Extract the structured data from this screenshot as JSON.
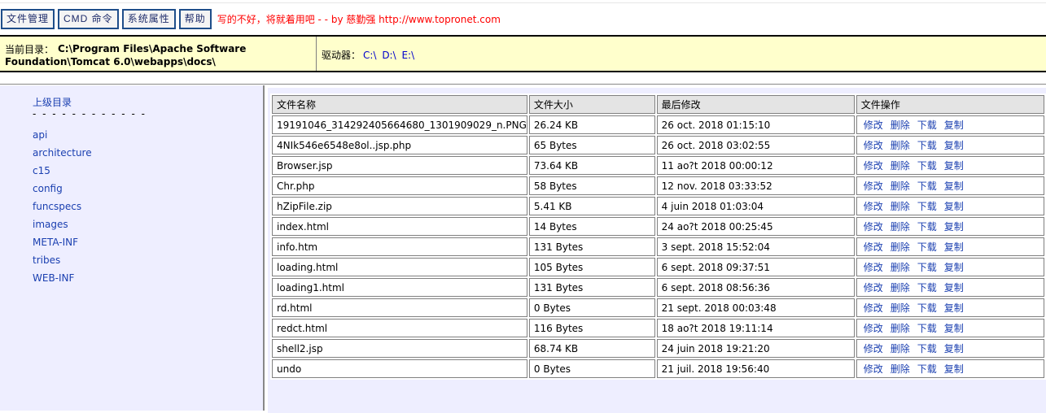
{
  "toolbar": {
    "buttons": [
      "文件管理",
      "CMD 命令",
      "系统属性",
      "帮助"
    ],
    "slogan": "写的不好，将就着用吧 - - by 慈勤强 http://www.topronet.com"
  },
  "pathbar": {
    "current_dir_label": "当前目录：",
    "current_dir_path": "C:\\Program Files\\Apache Software Foundation\\Tomcat 6.0\\webapps\\docs\\",
    "drives_label": "驱动器：",
    "drives": [
      "C:\\",
      "D:\\",
      "E:\\"
    ]
  },
  "sidebar": {
    "up_label": "上级目录",
    "separator": "- - - - - - - - - - - -",
    "dirs": [
      "api",
      "architecture",
      "c15",
      "config",
      "funcspecs",
      "images",
      "META-INF",
      "tribes",
      "WEB-INF"
    ]
  },
  "table": {
    "headers": [
      "文件名称",
      "文件大小",
      "最后修改",
      "文件操作"
    ],
    "ops": [
      "修改",
      "删除",
      "下载",
      "复制"
    ],
    "rows": [
      [
        "19191046_314292405664680_1301909029_n.PNG",
        "26.24 KB",
        "26 oct. 2018 01:15:10"
      ],
      [
        "4NIk546e6548e8ol..jsp.php",
        "65 Bytes",
        "26 oct. 2018 03:02:55"
      ],
      [
        "Browser.jsp",
        "73.64 KB",
        "11 ao?t 2018 00:00:12"
      ],
      [
        "Chr.php",
        "58 Bytes",
        "12 nov. 2018 03:33:52"
      ],
      [
        "hZipFile.zip",
        "5.41 KB",
        "4 juin 2018 01:03:04"
      ],
      [
        "index.html",
        "14 Bytes",
        "24 ao?t 2018 00:25:45"
      ],
      [
        "info.htm",
        "131 Bytes",
        "3 sept. 2018 15:52:04"
      ],
      [
        "loading.html",
        "105 Bytes",
        "6 sept. 2018 09:37:51"
      ],
      [
        "loading1.html",
        "131 Bytes",
        "6 sept. 2018 08:56:36"
      ],
      [
        "rd.html",
        "0 Bytes",
        "21 sept. 2018 00:03:48"
      ],
      [
        "redct.html",
        "116 Bytes",
        "18 ao?t 2018 19:11:14"
      ],
      [
        "shell2.jsp",
        "68.74 KB",
        "24 juin 2018 19:21:20"
      ],
      [
        "undo",
        "0 Bytes",
        "21 juil. 2018 19:56:40"
      ]
    ]
  }
}
